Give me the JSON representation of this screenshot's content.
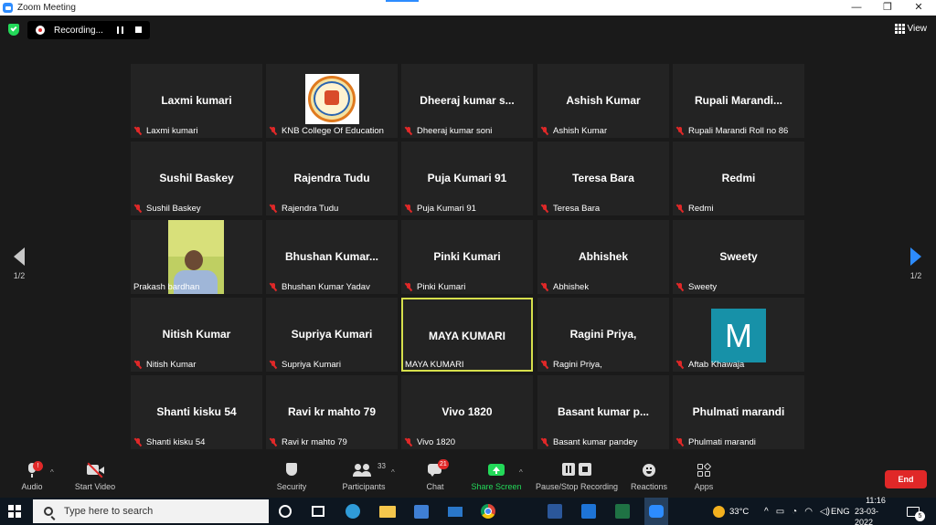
{
  "window": {
    "title": "Zoom Meeting"
  },
  "recording": {
    "label": "Recording..."
  },
  "view_button": {
    "label": "View"
  },
  "pager": {
    "left_label": "1/2",
    "right_label": "1/2"
  },
  "tiles": [
    {
      "name": "Laxmi kumari",
      "label": "Laxmi kumari"
    },
    {
      "name": "",
      "label": "KNB College Of Education"
    },
    {
      "name": "Dheeraj  kumar  s...",
      "label": "Dheeraj kumar soni"
    },
    {
      "name": "Ashish Kumar",
      "label": "Ashish Kumar"
    },
    {
      "name": "Rupali  Marandi...",
      "label": "Rupali Marandi Roll no 86"
    },
    {
      "name": "Sushil Baskey",
      "label": "Sushil Baskey"
    },
    {
      "name": "Rajendra Tudu",
      "label": "Rajendra Tudu"
    },
    {
      "name": "Puja Kumari 91",
      "label": "Puja Kumari 91"
    },
    {
      "name": "Teresa Bara",
      "label": "Teresa Bara"
    },
    {
      "name": "Redmi",
      "label": "Redmi"
    },
    {
      "name": "",
      "label": "Prakash bardhan"
    },
    {
      "name": "Bhushan  Kumar...",
      "label": "Bhushan Kumar Yadav"
    },
    {
      "name": "Pinki Kumari",
      "label": "Pinki Kumari"
    },
    {
      "name": "Abhishek",
      "label": "Abhishek"
    },
    {
      "name": "Sweety",
      "label": "Sweety"
    },
    {
      "name": "Nitish Kumar",
      "label": "Nitish Kumar"
    },
    {
      "name": "Supriya Kumari",
      "label": "Supriya Kumari"
    },
    {
      "name": "MAYA KUMARI",
      "label": "MAYA KUMARI"
    },
    {
      "name": "Ragini Priya,",
      "label": "Ragini Priya,"
    },
    {
      "name": "M",
      "label": "Aftab Khawaja"
    },
    {
      "name": "Shanti kisku 54",
      "label": "Shanti kisku 54"
    },
    {
      "name": "Ravi kr mahto 79",
      "label": "Ravi kr mahto 79"
    },
    {
      "name": "Vivo 1820",
      "label": "Vivo 1820"
    },
    {
      "name": "Basant  kumar  p...",
      "label": "Basant kumar pandey"
    },
    {
      "name": "Phulmati marandi",
      "label": "Phulmati marandi"
    }
  ],
  "toolbar": {
    "audio": "Audio",
    "start_video": "Start Video",
    "security": "Security",
    "participants": "Participants",
    "participants_count": "33",
    "chat": "Chat",
    "chat_badge": "21",
    "audio_badge": "!",
    "share_screen": "Share Screen",
    "pause_stop_recording": "Pause/Stop Recording",
    "reactions": "Reactions",
    "apps": "Apps",
    "end": "End"
  },
  "taskbar": {
    "search_placeholder": "Type here to search",
    "temperature": "33°C",
    "language": "ENG",
    "time": "11:16",
    "date": "23-03-2022",
    "notification_count": "5"
  },
  "colors": {
    "background": "#1a1a1a",
    "tile": "#232323",
    "active_speaker": "#d6df4c",
    "zoom_blue": "#2d8cff",
    "muted_red": "#e02828",
    "share_green": "#23d959",
    "end_red": "#e02828"
  }
}
